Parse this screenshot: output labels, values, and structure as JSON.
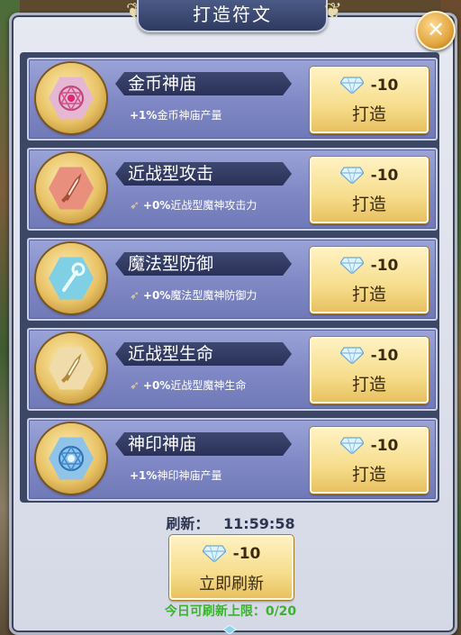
{
  "dialog": {
    "title": "打造符文",
    "close_icon": "close-icon"
  },
  "runes": [
    {
      "name": "金币神庙",
      "bonus_value": "+1%",
      "bonus_text": "金币神庙产量",
      "cost": "-10",
      "action": "打造",
      "icon": "gold-temple-icon",
      "hex_color": "#e5b7d2",
      "has_feather": false
    },
    {
      "name": "近战型攻击",
      "bonus_value": "+0%",
      "bonus_text": "近战型魔神攻击力",
      "cost": "-10",
      "action": "打造",
      "icon": "melee-attack-icon",
      "hex_color": "#e98f7d",
      "has_feather": true
    },
    {
      "name": "魔法型防御",
      "bonus_value": "+0%",
      "bonus_text": "魔法型魔神防御力",
      "cost": "-10",
      "action": "打造",
      "icon": "magic-defense-icon",
      "hex_color": "#7fd0e4",
      "has_feather": true
    },
    {
      "name": "近战型生命",
      "bonus_value": "+0%",
      "bonus_text": "近战型魔神生命",
      "cost": "-10",
      "action": "打造",
      "icon": "melee-life-icon",
      "hex_color": "#efdcaa",
      "has_feather": true
    },
    {
      "name": "神印神庙",
      "bonus_value": "+1%",
      "bonus_text": "神印神庙产量",
      "cost": "-10",
      "action": "打造",
      "icon": "seal-temple-icon",
      "hex_color": "#8fc4e8",
      "has_feather": false
    }
  ],
  "refresh": {
    "label": "刷新：",
    "timer": "11:59:58",
    "cost": "-10",
    "button_label": "立即刷新",
    "limit_text": "今日可刷新上限：0/20"
  },
  "colors": {
    "title_plate": "#2f3a61",
    "row_bg": "#7f88c4",
    "button_gold": "#f6dd8c",
    "limit_green": "#39b42c"
  }
}
